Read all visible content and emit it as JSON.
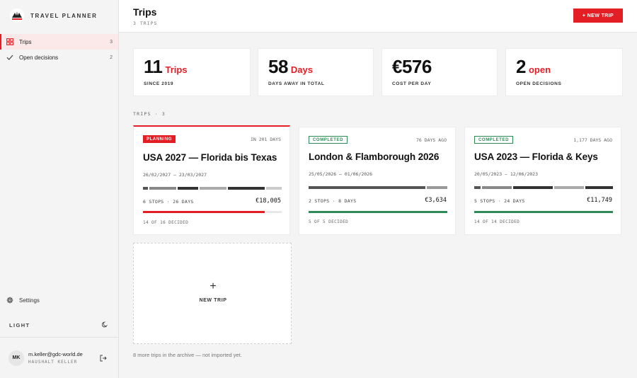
{
  "app": {
    "name": "TRAVEL PLANNER"
  },
  "sidebar": {
    "items": [
      {
        "label": "Trips",
        "count": "3",
        "icon": "grid-icon",
        "active": true
      },
      {
        "label": "Open decisions",
        "count": "2",
        "icon": "check-icon",
        "active": false
      }
    ],
    "settings_label": "Settings",
    "theme_label": "LIGHT",
    "user": {
      "initials": "MK",
      "email": "m.keller@gdc-world.de",
      "household": "HAUSHALT KELLER"
    }
  },
  "header": {
    "title": "Trips",
    "subtitle": "3 TRIPS",
    "new_trip_label": "+ NEW TRIP"
  },
  "stats": [
    {
      "number": "11",
      "unit": "Trips",
      "label": "SINCE 2019"
    },
    {
      "number": "58",
      "unit": "Days",
      "label": "DAYS AWAY IN TOTAL"
    },
    {
      "number": "€576",
      "unit": "",
      "label": "COST PER DAY"
    },
    {
      "number": "2",
      "unit": "open",
      "label": "OPEN DECISIONS"
    }
  ],
  "section_label": "TRIPS · 3",
  "trips": [
    {
      "status": "PLANNING",
      "status_type": "planning",
      "when": "IN 201 DAYS",
      "title": "USA 2027 — Florida bis Texas",
      "dates": "26/02/2027 – 23/03/2027",
      "segments": [
        4,
        20,
        16,
        20,
        28,
        12
      ],
      "segment_colors": [
        "#555555",
        "#888888",
        "#333333",
        "#aaaaaa",
        "#333333",
        "#cccccc"
      ],
      "stops": "6 STOPS · 26 DAYS",
      "cost": "€18,005",
      "decided_fraction": 0.875,
      "progress_color": "#e31e24",
      "decided": "14 OF 16 DECIDED"
    },
    {
      "status": "COMPLETED",
      "status_type": "completed",
      "when": "76 DAYS AGO",
      "title": "London & Flamborough 2026",
      "dates": "25/05/2026 – 01/06/2026",
      "segments": [
        85,
        15
      ],
      "segment_colors": [
        "#555555",
        "#999999"
      ],
      "stops": "2 STOPS · 8 DAYS",
      "cost": "€3,634",
      "decided_fraction": 1.0,
      "progress_color": "#2e8b57",
      "decided": "5 OF 5 DECIDED"
    },
    {
      "status": "COMPLETED",
      "status_type": "completed",
      "when": "1,177 DAYS AGO",
      "title": "USA 2023 — Florida & Keys",
      "dates": "20/05/2023 – 12/06/2023",
      "segments": [
        5,
        22,
        30,
        22,
        21
      ],
      "segment_colors": [
        "#555555",
        "#888888",
        "#333333",
        "#aaaaaa",
        "#333333"
      ],
      "stops": "5 STOPS · 24 DAYS",
      "cost": "€11,749",
      "decided_fraction": 1.0,
      "progress_color": "#2e8b57",
      "decided": "14 OF 14 DECIDED"
    }
  ],
  "new_card": {
    "plus": "+",
    "label": "NEW TRIP"
  },
  "archive_note": "8 more trips in the archive — not imported yet."
}
